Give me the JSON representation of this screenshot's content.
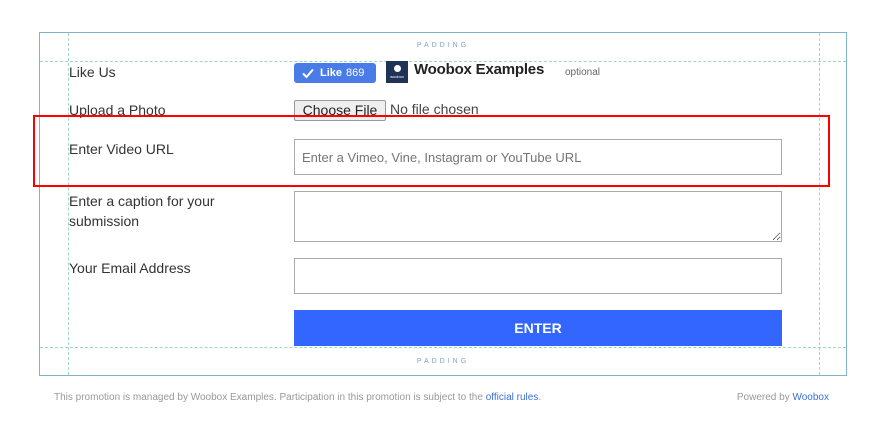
{
  "padding_label": "PADDING",
  "like_row": {
    "label": "Like Us",
    "like_button_label": "Like",
    "like_count": "869",
    "logo_text": "woobox",
    "page_name": "Woobox Examples",
    "optional_text": "optional"
  },
  "upload_row": {
    "label": "Upload a Photo",
    "button_label": "Choose File",
    "status_text": "No file chosen"
  },
  "video_row": {
    "label": "Enter Video URL",
    "placeholder": "Enter a Vimeo, Vine, Instagram or YouTube URL",
    "value": ""
  },
  "caption_row": {
    "label": "Enter a caption for your submission",
    "value": ""
  },
  "email_row": {
    "label": "Your Email Address",
    "value": ""
  },
  "submit_label": "ENTER",
  "footer": {
    "left_text": "This promotion is managed by Woobox Examples. Participation in this promotion is subject to the",
    "rules_link": "official rules",
    "period": ".",
    "powered_text": "Powered by",
    "brand_link": "Woobox"
  },
  "colors": {
    "accent": "#3366ff",
    "like_button": "#4a7ce8",
    "highlight": "#ff0000",
    "guide": "#9fd4c9"
  }
}
